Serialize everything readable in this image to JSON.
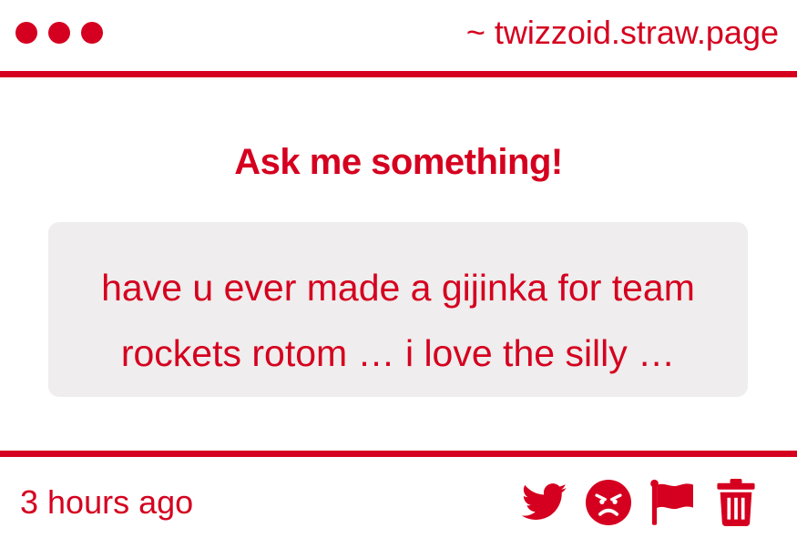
{
  "window": {
    "site": "~ twizzoid.straw.page"
  },
  "main": {
    "headline": "Ask me something!",
    "question": "have u ever made a gijinka for team rockets rotom … i love the silly …"
  },
  "footer": {
    "timestamp": "3 hours ago",
    "actions": [
      "twitter-icon",
      "angry-face-icon",
      "flag-icon",
      "trash-icon"
    ]
  },
  "colors": {
    "accent": "#d5001f",
    "box_background": "#efeded"
  }
}
